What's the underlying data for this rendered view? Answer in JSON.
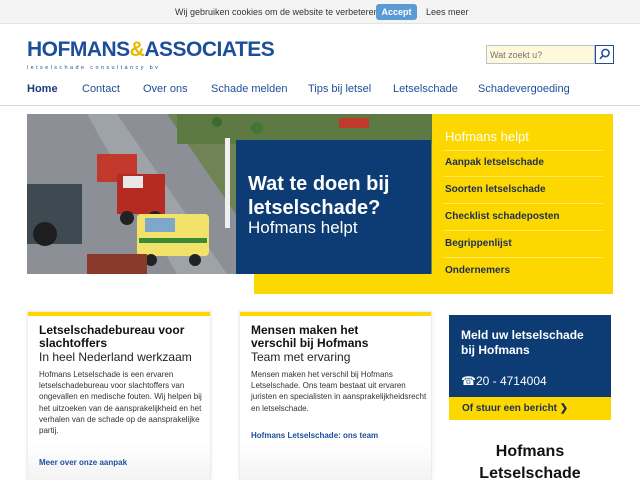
{
  "cookie": {
    "text": "Wij gebruiken cookies om de website te verbeteren.",
    "accept": "Accept",
    "more": "Lees meer"
  },
  "logo": {
    "name_a": "HOFMANS",
    "amp": "&",
    "name_b": "ASSOCIATES",
    "tagline": "letselschade consultancy bv"
  },
  "search": {
    "placeholder": "Wat zoekt u?"
  },
  "nav": {
    "items": [
      "Home",
      "Contact",
      "Over ons",
      "Schade melden",
      "Tips bij letsel",
      "Letselschade",
      "Schadevergoeding"
    ],
    "active": "Home"
  },
  "hero": {
    "title": "Wat te doen bij letselschade?",
    "subtitle": "Hofmans helpt"
  },
  "helpt": {
    "title": "Hofmans helpt",
    "links": [
      "Aanpak letselschade",
      "Soorten letselschade",
      "Checklist schadeposten",
      "Begrippenlijst",
      "Ondernemers"
    ]
  },
  "cards": [
    {
      "title": "Letselschadebureau voor slachtoffers",
      "subtitle": "In heel Nederland werkzaam",
      "body": "Hofmans Letselschade is een ervaren letselschadebureau voor slachtoffers van ongevallen en medische fouten. Wij helpen bij het uitzoeken van de aansprakelijkheid en het verhalen van de schade op de aansprakelijke partij.",
      "link": "Meer over onze aanpak"
    },
    {
      "title": "Mensen maken het verschil bij Hofmans",
      "subtitle": "Team met ervaring",
      "body": "Mensen maken het verschil bij Hofmans Letselschade. Ons team bestaat uit ervaren juristen en specialisten in aansprakelijkheidsrecht en letselschade.",
      "link": "Hofmans Letselschade: ons team"
    }
  ],
  "report": {
    "title": "Meld uw letselschade bij Hofmans",
    "phone": "☎20 - 4714004",
    "link": "Of stuur een bericht  ❯"
  },
  "side": {
    "title": "Hofmans Letselschade"
  },
  "colors": {
    "brand_blue": "#0d3b74",
    "nav_blue": "#1d4e9a",
    "yellow": "#fcd800",
    "search_bg": "#fff9d9"
  }
}
